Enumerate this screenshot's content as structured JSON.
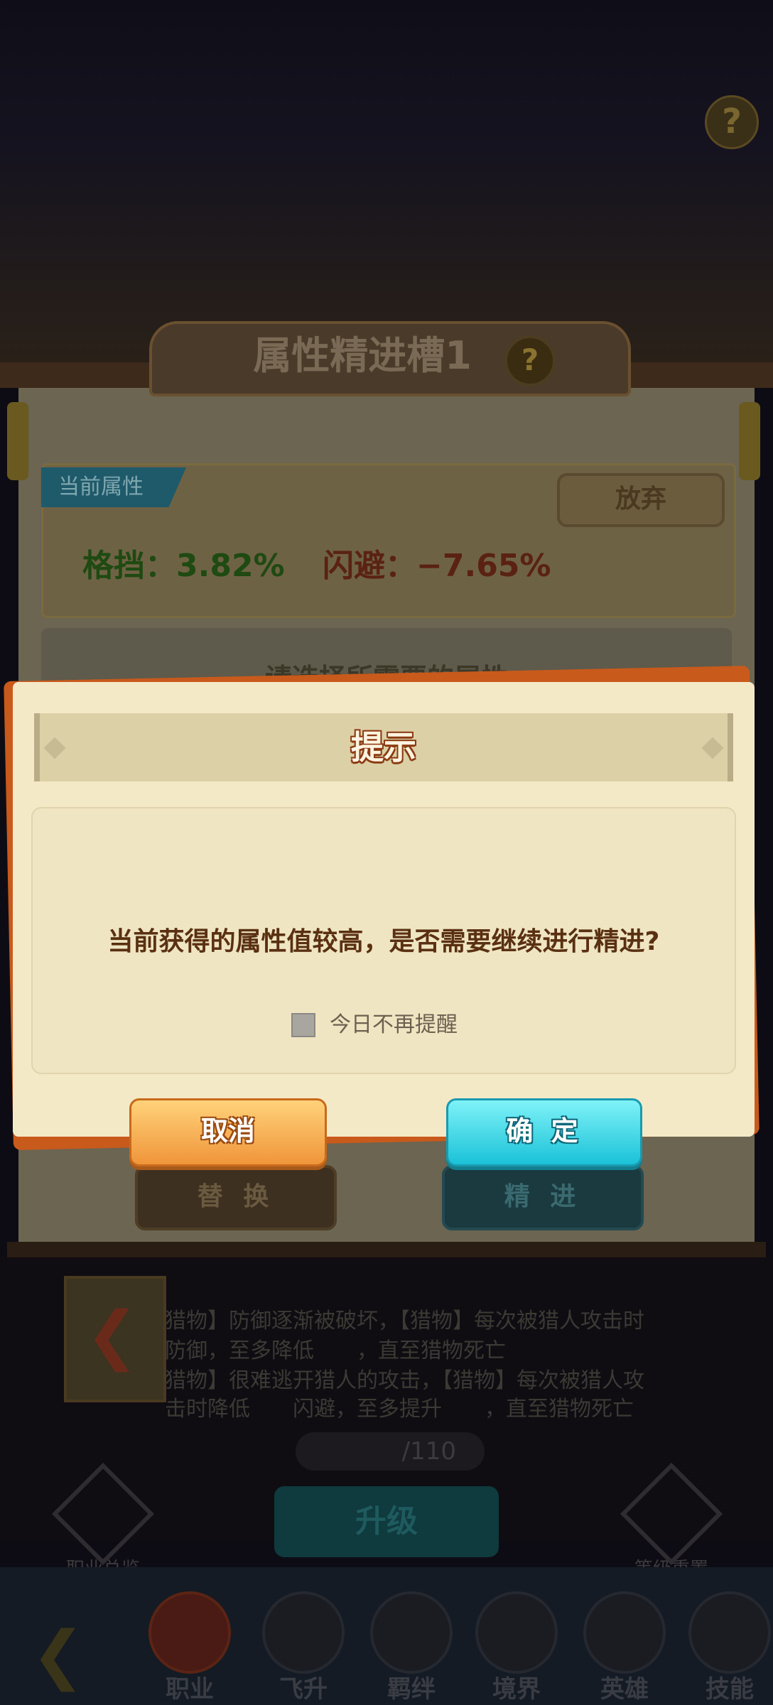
{
  "top": {
    "help_icon": "?"
  },
  "panel": {
    "title": "属性精进槽1",
    "help_icon": "?",
    "current_tag": "当前属性",
    "abandon_button": "放弃",
    "attributes": [
      {
        "label": "格挡：3.82%",
        "color": "#1f4a12"
      },
      {
        "label": "闪避：−7.65%",
        "color": "#5a2212"
      }
    ],
    "select_prompt": "请选择所需要的属性",
    "replace_button": "替 换",
    "refine_button": "精 进"
  },
  "background": {
    "desc_lines": [
      "猎物】防御逐渐被破坏，【猎物】每次被猎人攻击时",
      "防御，至多降低　　，直至猎物死亡",
      "猎物】很难逃开猎人的攻击，【猎物】每次被猎人攻",
      "击时降低　　闪避，至多提升　　，直至猎物死亡"
    ],
    "counter": "/110",
    "upgrade_button": "升级",
    "job_overview": "职业总览",
    "level_reset": "等级重置"
  },
  "nav": {
    "items": [
      {
        "label": "职业",
        "icon": "book-icon"
      },
      {
        "label": "飞升",
        "icon": "cloud-icon"
      },
      {
        "label": "羁绊",
        "icon": "bond-icon"
      },
      {
        "label": "境界",
        "icon": "realm-icon"
      },
      {
        "label": "英雄",
        "icon": "hero-icon"
      },
      {
        "label": "技能",
        "icon": "skill-icon"
      }
    ]
  },
  "dialog": {
    "title": "提示",
    "message": "当前获得的属性值较高，是否需要继续进行精进?",
    "checkbox_label": "今日不再提醒",
    "checkbox_checked": false,
    "cancel_button": "取消",
    "confirm_button": "确 定"
  }
}
